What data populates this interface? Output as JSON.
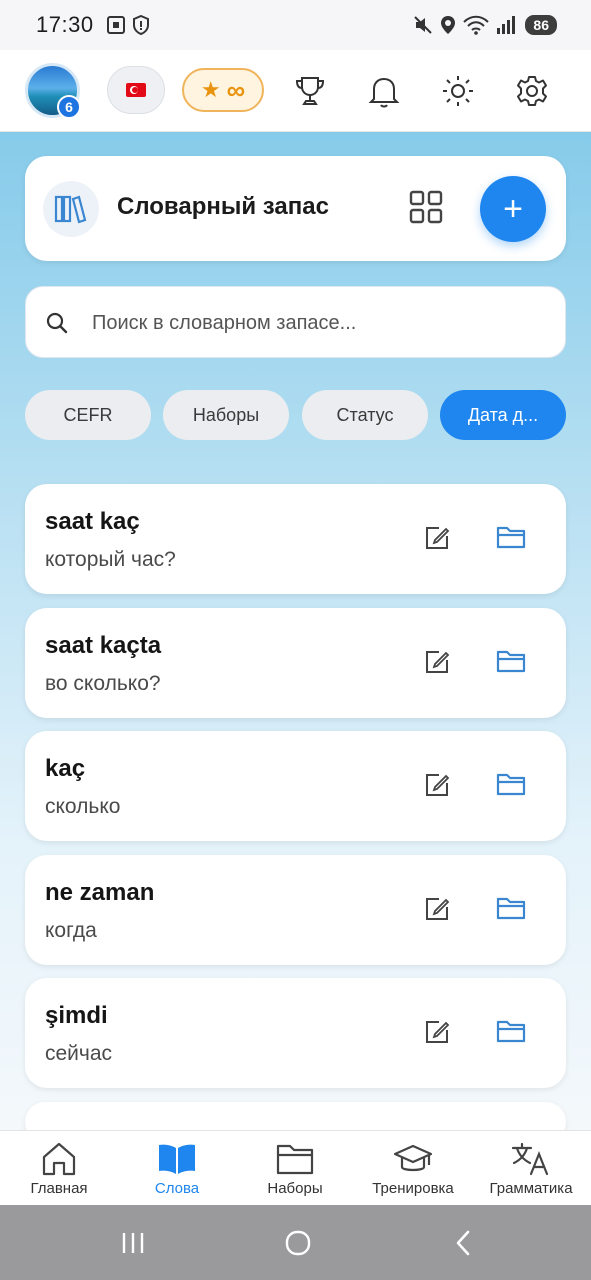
{
  "status_bar": {
    "time": "17:30",
    "battery": "86"
  },
  "top_bar": {
    "avatar_badge": "6",
    "premium_star": "★",
    "premium_label": "∞"
  },
  "header": {
    "title": "Словарный запас",
    "add_label": "+"
  },
  "search": {
    "placeholder": "Поиск в словарном запасе..."
  },
  "filters": [
    {
      "label": "CEFR",
      "active": false
    },
    {
      "label": "Наборы",
      "active": false
    },
    {
      "label": "Статус",
      "active": false
    },
    {
      "label": "Дата д...",
      "active": true
    }
  ],
  "words": [
    {
      "term": "saat kaç",
      "translation": "который час?"
    },
    {
      "term": "saat kaçta",
      "translation": "во сколько?"
    },
    {
      "term": "kaç",
      "translation": "сколько"
    },
    {
      "term": "ne zaman",
      "translation": "когда"
    },
    {
      "term": "şimdi",
      "translation": "сейчас"
    }
  ],
  "nav": [
    {
      "label": "Главная",
      "icon": "home-icon",
      "active": false
    },
    {
      "label": "Слова",
      "icon": "book-icon",
      "active": true
    },
    {
      "label": "Наборы",
      "icon": "folder-icon",
      "active": false
    },
    {
      "label": "Тренировка",
      "icon": "graduation-cap-icon",
      "active": false
    },
    {
      "label": "Грамматика",
      "icon": "translate-icon",
      "active": false
    }
  ],
  "colors": {
    "accent": "#1e86ee",
    "premium": "#e8940e",
    "folder_icon": "#3a86d0"
  }
}
